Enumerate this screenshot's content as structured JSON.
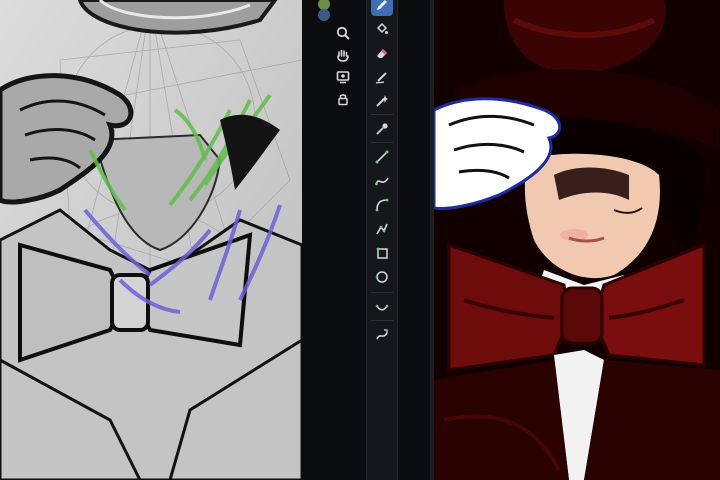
{
  "window": {
    "title": ""
  },
  "colors": {
    "canvas_sketch_bg": "#cfcfcf",
    "toolbar_bg": "#0b0c0e",
    "accent": "#3e6fb5",
    "swatch_primary": "#6e8f46",
    "swatch_secondary": "#3a5a8a",
    "render_dark_red": "#7a0e0e",
    "render_shadow": "#2a0202"
  },
  "toolbar_left": {
    "items": [
      {
        "icon": "zoom-icon"
      },
      {
        "icon": "hand-pan-icon"
      },
      {
        "icon": "reference-icon"
      },
      {
        "icon": "lock-icon"
      }
    ]
  },
  "toolbar_right": {
    "items": [
      {
        "icon": "pen-icon",
        "active": true
      },
      {
        "icon": "fill-bucket-icon"
      },
      {
        "icon": "eraser-icon"
      },
      {
        "icon": "smudge-icon"
      },
      {
        "icon": "eyedropper-sparkle-icon"
      },
      {
        "icon": "color-picker-icon"
      },
      {
        "icon": "straight-line-icon"
      },
      {
        "icon": "freehand-curve-icon"
      },
      {
        "icon": "arc-curve-icon"
      },
      {
        "icon": "polyline-icon"
      },
      {
        "icon": "rectangle-shape-icon"
      },
      {
        "icon": "ellipse-shape-icon"
      },
      {
        "icon": "curve-edit-icon"
      },
      {
        "icon": "stroke-adjust-icon"
      }
    ]
  }
}
